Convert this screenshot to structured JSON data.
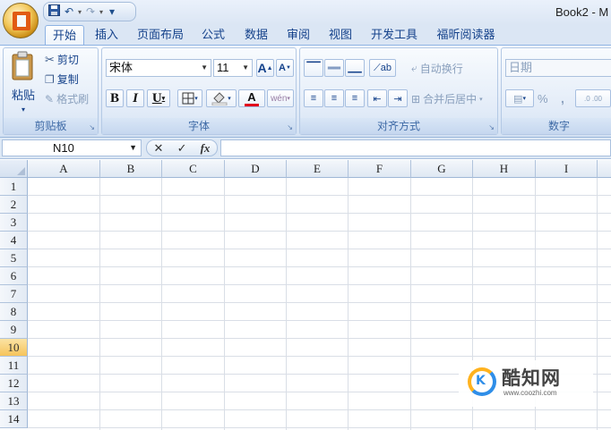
{
  "title_bar": {
    "title": "Book2 - M",
    "qat_undo": "↶",
    "qat_redo": "↷",
    "qat_customize": "▾"
  },
  "tabs": [
    "开始",
    "插入",
    "页面布局",
    "公式",
    "数据",
    "审阅",
    "视图",
    "开发工具",
    "福昕阅读器"
  ],
  "clipboard": {
    "paste_label": "粘贴",
    "cut_label": "剪切",
    "copy_label": "复制",
    "format_painter_label": "格式刷",
    "group_title": "剪贴板"
  },
  "font": {
    "font_name": "宋体",
    "font_size": "11",
    "grow_label": "A",
    "shrink_label": "A",
    "bold": "B",
    "italic": "I",
    "underline": "U",
    "font_color_label": "A",
    "phonetic_label": "wén",
    "group_title": "字体",
    "font_color": "#e1001b"
  },
  "alignment": {
    "wrap_text_label": "自动换行",
    "merge_center_label": "合并后居中",
    "group_title": "对齐方式"
  },
  "number": {
    "format_value": "日期",
    "percent_label": "%",
    "comma_label": ",",
    "increase_decimal_label": ".0 .00",
    "group_title": "数字"
  },
  "formula_bar": {
    "name_box": "N10",
    "cancel": "✕",
    "enter": "✓",
    "fx": "fx",
    "formula": ""
  },
  "sheet": {
    "columns": [
      "A",
      "B",
      "C",
      "D",
      "E",
      "F",
      "G",
      "H",
      "I"
    ],
    "rows": [
      "1",
      "2",
      "3",
      "4",
      "5",
      "6",
      "7",
      "8",
      "9",
      "10",
      "11",
      "12",
      "13",
      "14"
    ],
    "selected_row": "10"
  },
  "watermark": {
    "name": "酷知网",
    "url": "www.coozhi.com",
    "logo_text": "K"
  }
}
